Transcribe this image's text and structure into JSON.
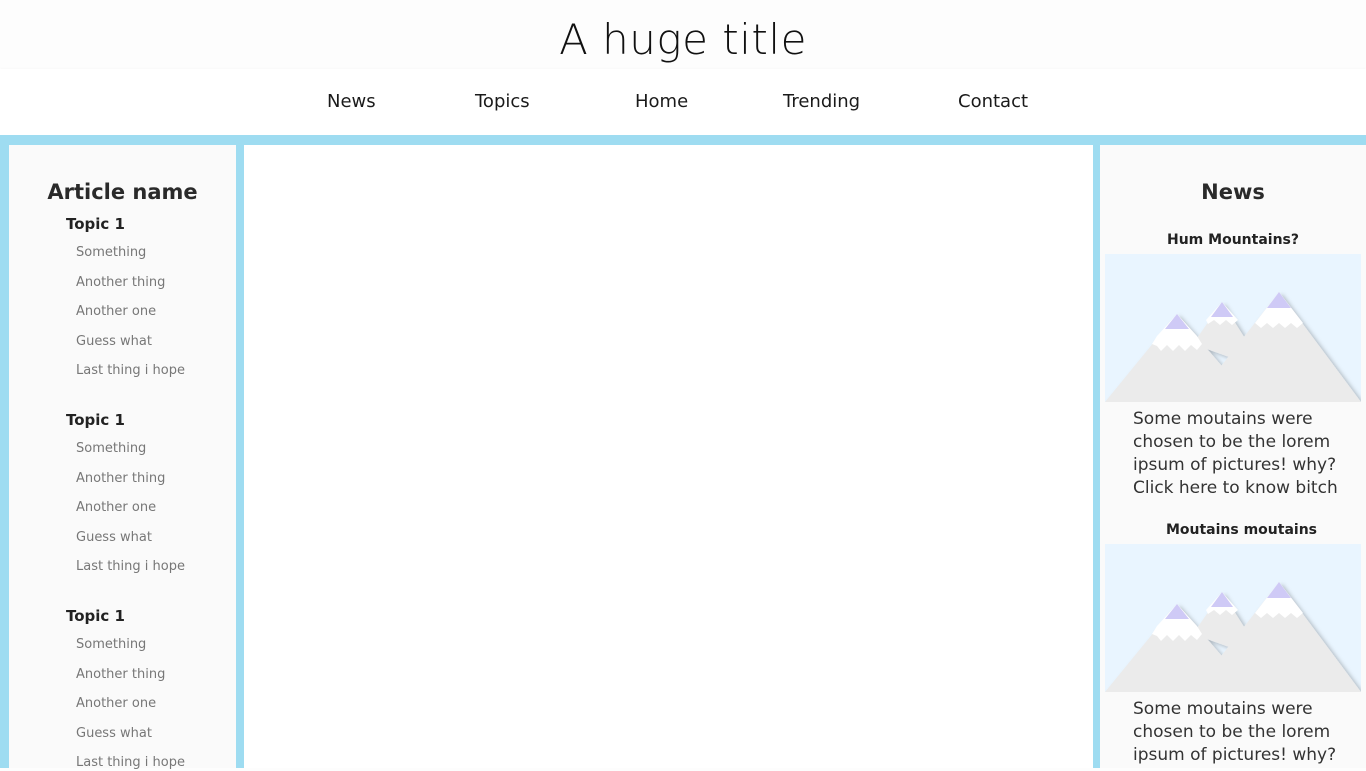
{
  "header": {
    "title": "A huge title"
  },
  "nav": {
    "items": [
      {
        "label": "News"
      },
      {
        "label": "Topics"
      },
      {
        "label": "Home"
      },
      {
        "label": "Trending"
      },
      {
        "label": "Contact"
      }
    ]
  },
  "sidebar": {
    "title": "Article name",
    "topics": [
      {
        "heading": "Topic 1",
        "items": [
          "Something",
          "Another thing",
          "Another one",
          "Guess what",
          "Last thing i hope"
        ]
      },
      {
        "heading": "Topic 1",
        "items": [
          "Something",
          "Another thing",
          "Another one",
          "Guess what",
          "Last thing i hope"
        ]
      },
      {
        "heading": "Topic 1",
        "items": [
          "Something",
          "Another thing",
          "Another one",
          "Guess what",
          "Last thing i hope"
        ]
      }
    ]
  },
  "news": {
    "title": "News",
    "cards": [
      {
        "title": "Hum Mountains?",
        "image_icon": "mountains-image",
        "text": "Some moutains were chosen to be the lorem ipsum of pictures! why? Click here to know bitch"
      },
      {
        "title": "Moutains moutains",
        "image_icon": "mountains-image",
        "text": "Some moutains were chosen to be the lorem ipsum of pictures! why? Click here to know bitch"
      }
    ]
  },
  "colors": {
    "accent": "#9edcf1",
    "panel": "#fafafa",
    "sky": "#e9f5ff",
    "mountain": "#ebebeb",
    "snow": "#ffffff",
    "peak": "#cfcaf6"
  }
}
